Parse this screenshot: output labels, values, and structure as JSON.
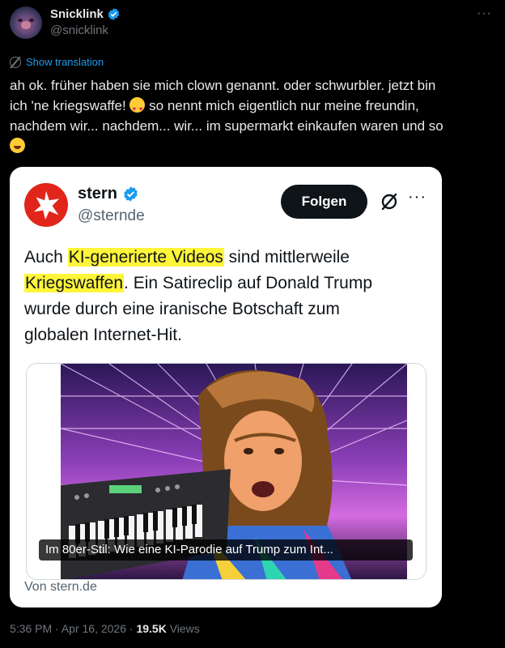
{
  "author": {
    "display_name": "Snicklink",
    "handle": "@snicklink",
    "avatar_icon": "blobfish-avatar",
    "verified": true
  },
  "more_icon": "more-horizontal-icon",
  "translate": {
    "label": "Show translation",
    "icon": "translate-icon"
  },
  "tweet": {
    "line1": "ah ok. früher haben sie mich clown genannt. oder schwurbler. jetzt bin",
    "line2a": "ich 'ne kriegswaffe! ",
    "emoji1": "heart-eyes-emoji",
    "line2b": " so nennt mich eigentlich nur meine freundin,",
    "line3": "nachdem wir... nachdem... wir... im supermarkt einkaufen waren und so",
    "emoji2": "rolling-laughing-emoji"
  },
  "quote": {
    "display_name": "stern",
    "handle": "@sternde",
    "follow_label": "Folgen",
    "text_1": "Auch ",
    "hl_1": "KI-generierte Videos",
    "text_2": " sind mittlerweile",
    "hl_2": "Kriegswaffen",
    "text_3": ". Ein Satireclip auf Donald Trump",
    "text_4": "wurde durch eine iranische Botschaft zum",
    "text_5": "globalen Internet-Hit.",
    "highlight_color": "#fff53a",
    "media": {
      "caption": "Im 80er-Stil: Wie eine KI-Parodie auf Trump zum Int...",
      "source": "Von stern.de",
      "image_icon": "synthwave-keyboard-portrait-image"
    }
  },
  "meta": {
    "time": "5:36 PM",
    "date": "Apr 16, 2026",
    "views_count": "19.5K",
    "views_label": "Views",
    "separator": "·"
  },
  "colors": {
    "background": "#000000",
    "link": "#1d9bf0",
    "verified": "#1d9bf0",
    "stern_red": "#e1251b"
  }
}
